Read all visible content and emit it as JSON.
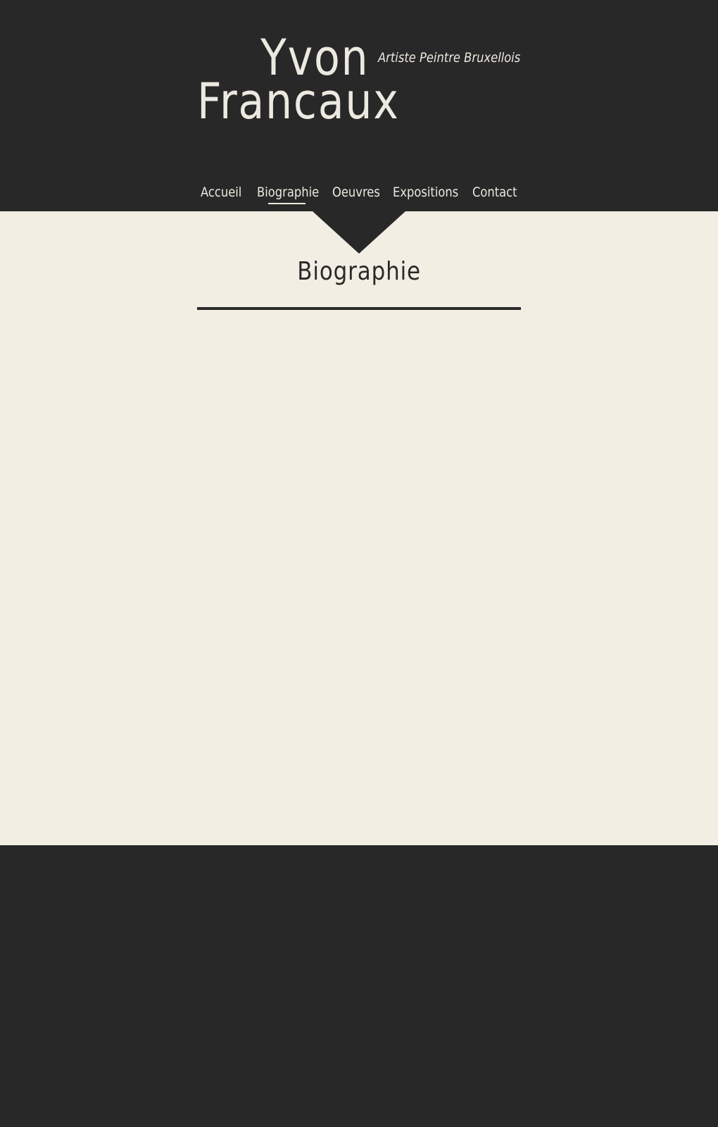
{
  "site": {
    "name_first": "Yvon",
    "name_last": "Francaux",
    "tagline": "Artiste Peintre Bruxellois"
  },
  "nav": {
    "items": [
      {
        "label": "Accueil",
        "active": false
      },
      {
        "label": "Biographie",
        "active": true
      },
      {
        "label": "Oeuvres",
        "active": false
      },
      {
        "label": "Expositions",
        "active": false
      },
      {
        "label": "Contact",
        "active": false
      }
    ]
  },
  "main": {
    "title": "Biographie"
  },
  "colors": {
    "dark": "#282828",
    "cream": "#f2eee3",
    "light_text": "#ece9e0",
    "heading_text": "#2a2a2a"
  }
}
